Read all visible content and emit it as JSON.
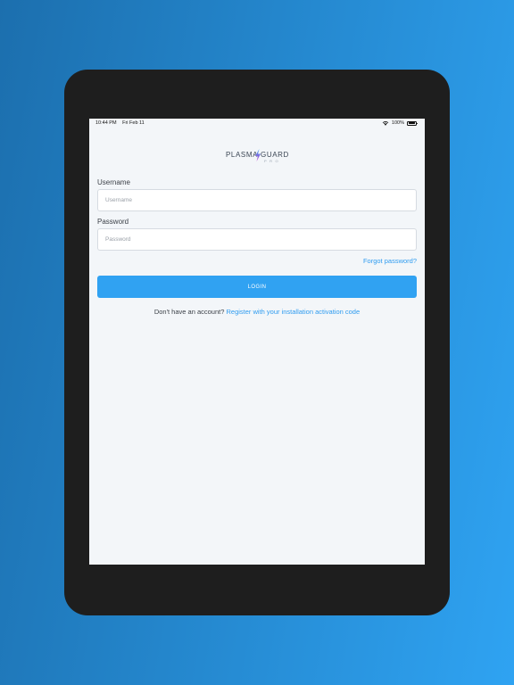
{
  "status_bar": {
    "time": "10:44 PM",
    "date": "Fri Feb 11",
    "battery": "100%",
    "wifi_icon": "wifi-icon",
    "battery_icon": "battery-icon"
  },
  "logo": {
    "left_text": "PLASMA",
    "right_text": "GUARD",
    "sub_text": "PRO",
    "colors": {
      "text": "#3b4654",
      "bolt_top": "#2fa3f2",
      "bolt_bottom": "#c23bd4"
    }
  },
  "form": {
    "username_label": "Username",
    "username_placeholder": "Username",
    "username_value": "",
    "password_label": "Password",
    "password_placeholder": "Password",
    "password_value": "",
    "forgot_password": "Forgot password?",
    "login_button": "LOGIN"
  },
  "register": {
    "prompt": "Don't have an account?",
    "link": "Register with your installation activation code"
  },
  "colors": {
    "accent": "#30a2f2",
    "link": "#2f9cf0",
    "screen_background": "#f3f6f9",
    "device_frame": "#1e1e1e"
  }
}
